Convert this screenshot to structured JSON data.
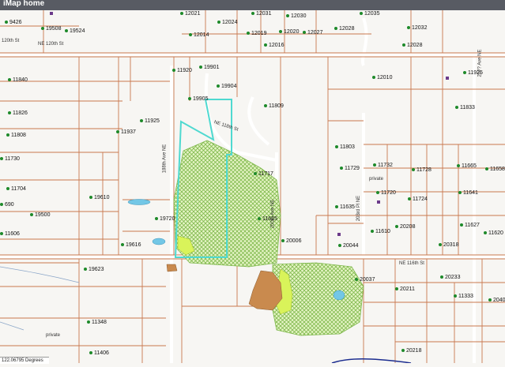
{
  "app": {
    "title": "iMap home"
  },
  "streets": [
    {
      "id": "120th-st",
      "label": "120th St"
    },
    {
      "id": "ne-120th-st",
      "label": "NE 120th St"
    },
    {
      "id": "ne-118th-st",
      "label": "NE 118th St"
    },
    {
      "id": "188th-ave-ne",
      "label": "188th Ave NE"
    },
    {
      "id": "200th-ave-ne",
      "label": "200th Ave NE"
    },
    {
      "id": "203rd-pl-ne",
      "label": "203rd Pl NE"
    },
    {
      "id": "ne-116th-st",
      "label": "NE 116th St"
    },
    {
      "id": "private-1",
      "label": "private"
    },
    {
      "id": "private-2",
      "label": "private"
    },
    {
      "id": "ave-ne-right",
      "label": "20?? Ave NE"
    }
  ],
  "parcels": [
    "9426",
    "19508",
    "19524",
    "12021",
    "12024",
    "12031",
    "12030",
    "12035",
    "12032",
    "12014",
    "12019",
    "12020",
    "12027",
    "12028",
    "12016",
    "12028",
    "11920",
    "19901",
    "19904",
    "19905",
    "11840",
    "11826",
    "11808",
    "11925",
    "11937",
    "11809",
    "12010",
    "11925",
    "11833",
    "11730",
    "11704",
    "11717",
    "11803",
    "11729",
    "11732",
    "11728",
    "11665",
    "11658",
    "19610",
    "11615",
    "11720",
    "11724",
    "11641",
    "690",
    "19500",
    "19720",
    "11635",
    "11627",
    "11606",
    "19616",
    "20006",
    "11610",
    "20208",
    "20318",
    "20044",
    "11620",
    "19623",
    "20037",
    "20233",
    "20211",
    "11333",
    "2040",
    "11348",
    "11406",
    "20218"
  ],
  "coords": {
    "readout": "122.06795 Degrees"
  },
  "colors": {
    "topbar": "#585b63",
    "parcel_line": "#c8784e",
    "selected_outline": "#4fd9d0",
    "hatch": "#9bd36a",
    "pond": "#73c7e6",
    "brown": "#c98a4e",
    "yellow": "#d9f35a",
    "point": "#1e8a2a"
  }
}
